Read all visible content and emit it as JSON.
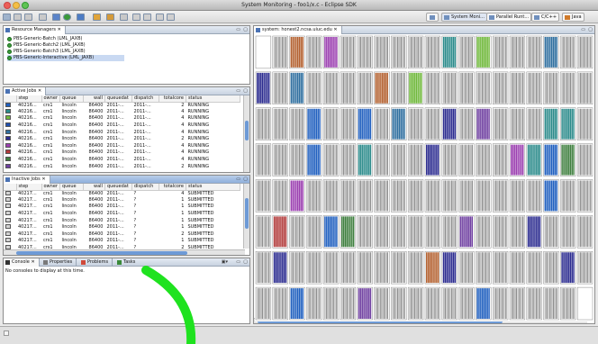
{
  "window": {
    "title": "System Monitoring - foo1/x.c - Eclipse SDK"
  },
  "perspectives": [
    {
      "label": "System Moni...",
      "active": true
    },
    {
      "label": "Parallel Runt...",
      "active": false
    },
    {
      "label": "C/C++",
      "active": false
    },
    {
      "label": "Java",
      "active": false
    }
  ],
  "resource_managers": {
    "tab_label": "Resource Managers",
    "items": [
      {
        "label": "PBS-Generic-Batch (LML_JAXB)"
      },
      {
        "label": "PBS-Generic-Batch2 (LML_JAXB)"
      },
      {
        "label": "PBS-Generic-Batch3 (LML_JAXB)"
      },
      {
        "label": "PBS-Generic-Interactive (LML_JAXB)"
      }
    ]
  },
  "active_jobs": {
    "tab_label": "Active Jobs",
    "columns": [
      "",
      "step",
      "owner",
      "queue",
      "wall",
      "queuedat",
      "dispatch",
      "totalcore",
      "status"
    ],
    "rows": [
      {
        "color": "#1f5fbf",
        "step": "40216...",
        "owner": "crs1",
        "queue": "lincoln",
        "wall": "86400",
        "queuedat": "2011-...",
        "dispatch": "2011-...",
        "totalcore": "2",
        "status": "RUNNING"
      },
      {
        "color": "#2a8a8a",
        "step": "40216...",
        "owner": "crs1",
        "queue": "lincoln",
        "wall": "86400",
        "queuedat": "2011-...",
        "dispatch": "2011-...",
        "totalcore": "4",
        "status": "RUNNING"
      },
      {
        "color": "#6fb83a",
        "step": "40216...",
        "owner": "crs1",
        "queue": "lincoln",
        "wall": "86400",
        "queuedat": "2011-...",
        "dispatch": "2011-...",
        "totalcore": "4",
        "status": "RUNNING"
      },
      {
        "color": "#1f4faf",
        "step": "40216...",
        "owner": "crs1",
        "queue": "lincoln",
        "wall": "86400",
        "queuedat": "2011-...",
        "dispatch": "2011-...",
        "totalcore": "4",
        "status": "RUNNING"
      },
      {
        "color": "#2f6f9f",
        "step": "40216...",
        "owner": "crs1",
        "queue": "lincoln",
        "wall": "86400",
        "queuedat": "2011-...",
        "dispatch": "2011-...",
        "totalcore": "4",
        "status": "RUNNING"
      },
      {
        "color": "#2b2b8f",
        "step": "40216...",
        "owner": "crs1",
        "queue": "lincoln",
        "wall": "86400",
        "queuedat": "2011-...",
        "dispatch": "2011-...",
        "totalcore": "2",
        "status": "RUNNING"
      },
      {
        "color": "#9b3fb0",
        "step": "40216...",
        "owner": "crs1",
        "queue": "lincoln",
        "wall": "86400",
        "queuedat": "2011-...",
        "dispatch": "2011-...",
        "totalcore": "4",
        "status": "RUNNING"
      },
      {
        "color": "#b23a3a",
        "step": "40216...",
        "owner": "crs1",
        "queue": "lincoln",
        "wall": "86400",
        "queuedat": "2011-...",
        "dispatch": "2011-...",
        "totalcore": "4",
        "status": "RUNNING"
      },
      {
        "color": "#3f7f3f",
        "step": "40216...",
        "owner": "crs1",
        "queue": "lincoln",
        "wall": "86400",
        "queuedat": "2011-...",
        "dispatch": "2011-...",
        "totalcore": "4",
        "status": "RUNNING"
      },
      {
        "color": "#6f3fa0",
        "step": "40216...",
        "owner": "crs1",
        "queue": "lincoln",
        "wall": "86400",
        "queuedat": "2011-...",
        "dispatch": "2011-...",
        "totalcore": "2",
        "status": "RUNNING"
      }
    ]
  },
  "inactive_jobs": {
    "tab_label": "Inactive Jobs",
    "columns": [
      "",
      "step",
      "owner",
      "queue",
      "wall",
      "queuedat",
      "dispatch",
      "totalcore",
      "status"
    ],
    "rows": [
      {
        "step": "40217...",
        "owner": "crs1",
        "queue": "lincoln",
        "wall": "86400",
        "queuedat": "2011-...",
        "dispatch": "?",
        "totalcore": "4",
        "status": "SUBMITTED"
      },
      {
        "step": "40217...",
        "owner": "crs1",
        "queue": "lincoln",
        "wall": "86400",
        "queuedat": "2011-...",
        "dispatch": "?",
        "totalcore": "1",
        "status": "SUBMITTED"
      },
      {
        "step": "40217...",
        "owner": "crs1",
        "queue": "lincoln",
        "wall": "86400",
        "queuedat": "2011-...",
        "dispatch": "?",
        "totalcore": "1",
        "status": "SUBMITTED"
      },
      {
        "step": "40217...",
        "owner": "crs1",
        "queue": "lincoln",
        "wall": "86400",
        "queuedat": "2011-...",
        "dispatch": "?",
        "totalcore": "1",
        "status": "SUBMITTED"
      },
      {
        "step": "40217...",
        "owner": "crs1",
        "queue": "lincoln",
        "wall": "86400",
        "queuedat": "2011-...",
        "dispatch": "?",
        "totalcore": "1",
        "status": "SUBMITTED"
      },
      {
        "step": "40217...",
        "owner": "crs1",
        "queue": "lincoln",
        "wall": "86400",
        "queuedat": "2011-...",
        "dispatch": "?",
        "totalcore": "1",
        "status": "SUBMITTED"
      },
      {
        "step": "40217...",
        "owner": "crs1",
        "queue": "lincoln",
        "wall": "86400",
        "queuedat": "2011-...",
        "dispatch": "?",
        "totalcore": "2",
        "status": "SUBMITTED"
      },
      {
        "step": "40217...",
        "owner": "crs1",
        "queue": "lincoln",
        "wall": "86400",
        "queuedat": "2011-...",
        "dispatch": "?",
        "totalcore": "1",
        "status": "SUBMITTED"
      },
      {
        "step": "40217...",
        "owner": "crs1",
        "queue": "lincoln",
        "wall": "86400",
        "queuedat": "2011-...",
        "dispatch": "?",
        "totalcore": "2",
        "status": "SUBMITTED"
      }
    ]
  },
  "bottom_tabs": {
    "tabs": [
      {
        "label": "Console"
      },
      {
        "label": "Properties"
      },
      {
        "label": "Problems"
      },
      {
        "label": "Tasks"
      }
    ],
    "message": "No consoles to display at this time."
  },
  "system_view": {
    "tab_label": "system: honest2.ncsa.uiuc.edu",
    "job_colors": [
      "#2a8a8a",
      "#6f3fa0",
      "#b3602f",
      "#1f5fbf",
      "#6fb83a",
      "#b23a3a",
      "#3f7f3f",
      "#2b2b8f",
      "#9b3fb0",
      "#2f6f9f"
    ]
  },
  "colors": {
    "arrow": "#1fe21f",
    "selection": "#c9d9f2",
    "scroll_thumb": "#6d9ad6"
  }
}
